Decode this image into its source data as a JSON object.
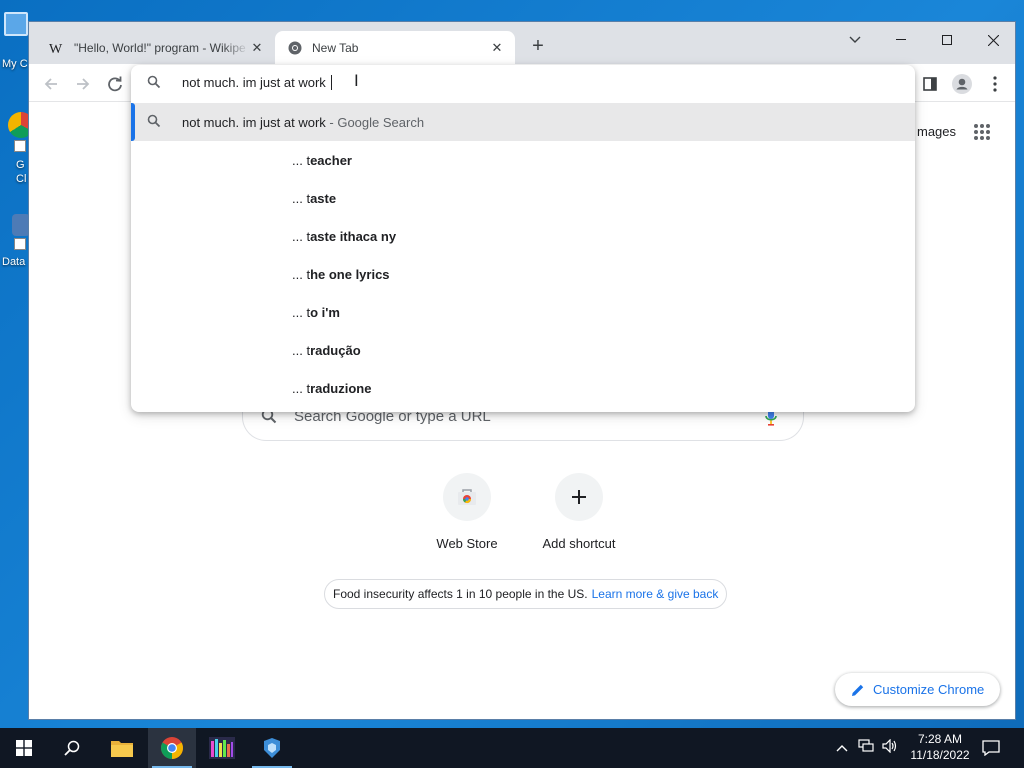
{
  "desktop": {
    "icons": [
      {
        "label": "My C"
      },
      {
        "label": "G\nCl"
      },
      {
        "label": "Data"
      }
    ]
  },
  "browser": {
    "tabs": [
      {
        "title": "\"Hello, World!\" program - Wikipe",
        "favicon": "wikipedia-icon",
        "active": false
      },
      {
        "title": "New Tab",
        "favicon": "chrome-icon",
        "active": true
      }
    ],
    "new_tab_symbol": "+",
    "window_controls": [
      "chevron-down-icon",
      "minimize-icon",
      "maximize-icon",
      "close-icon"
    ]
  },
  "omnibox": {
    "input_value": "not much. im just at work ",
    "suggestions": [
      {
        "text": "not much. im just at work",
        "suffix": " - Google Search",
        "type": "search",
        "selected": true
      },
      {
        "prefix": "... t",
        "bold": "eacher"
      },
      {
        "prefix": "... t",
        "bold": "aste"
      },
      {
        "prefix": "... t",
        "bold": "aste ithaca ny"
      },
      {
        "prefix": "... t",
        "bold": "he one lyrics"
      },
      {
        "prefix": "... t",
        "bold": "o i'm"
      },
      {
        "prefix": "... t",
        "bold": "radução"
      },
      {
        "prefix": "... t",
        "bold": "raduzione"
      }
    ]
  },
  "ntp": {
    "images_link": "mages",
    "search_placeholder": "Search Google or type a URL",
    "shortcuts": [
      {
        "label": "Web Store",
        "icon": "web-store-icon"
      },
      {
        "label": "Add shortcut",
        "icon": "plus-icon"
      }
    ],
    "promo_text": "Food insecurity affects 1 in 10 people in the US.",
    "promo_link": "Learn more & give back",
    "customize_label": "Customize Chrome"
  },
  "taskbar": {
    "apps": [
      "start-icon",
      "search-icon",
      "file-explorer-icon",
      "chrome-icon",
      "app-icon-1",
      "app-icon-2"
    ],
    "time": "7:28 AM",
    "date": "11/18/2022"
  },
  "colors": {
    "accent": "#1a73e8",
    "taskbar": "#101723",
    "desktop": "#1177cc"
  }
}
